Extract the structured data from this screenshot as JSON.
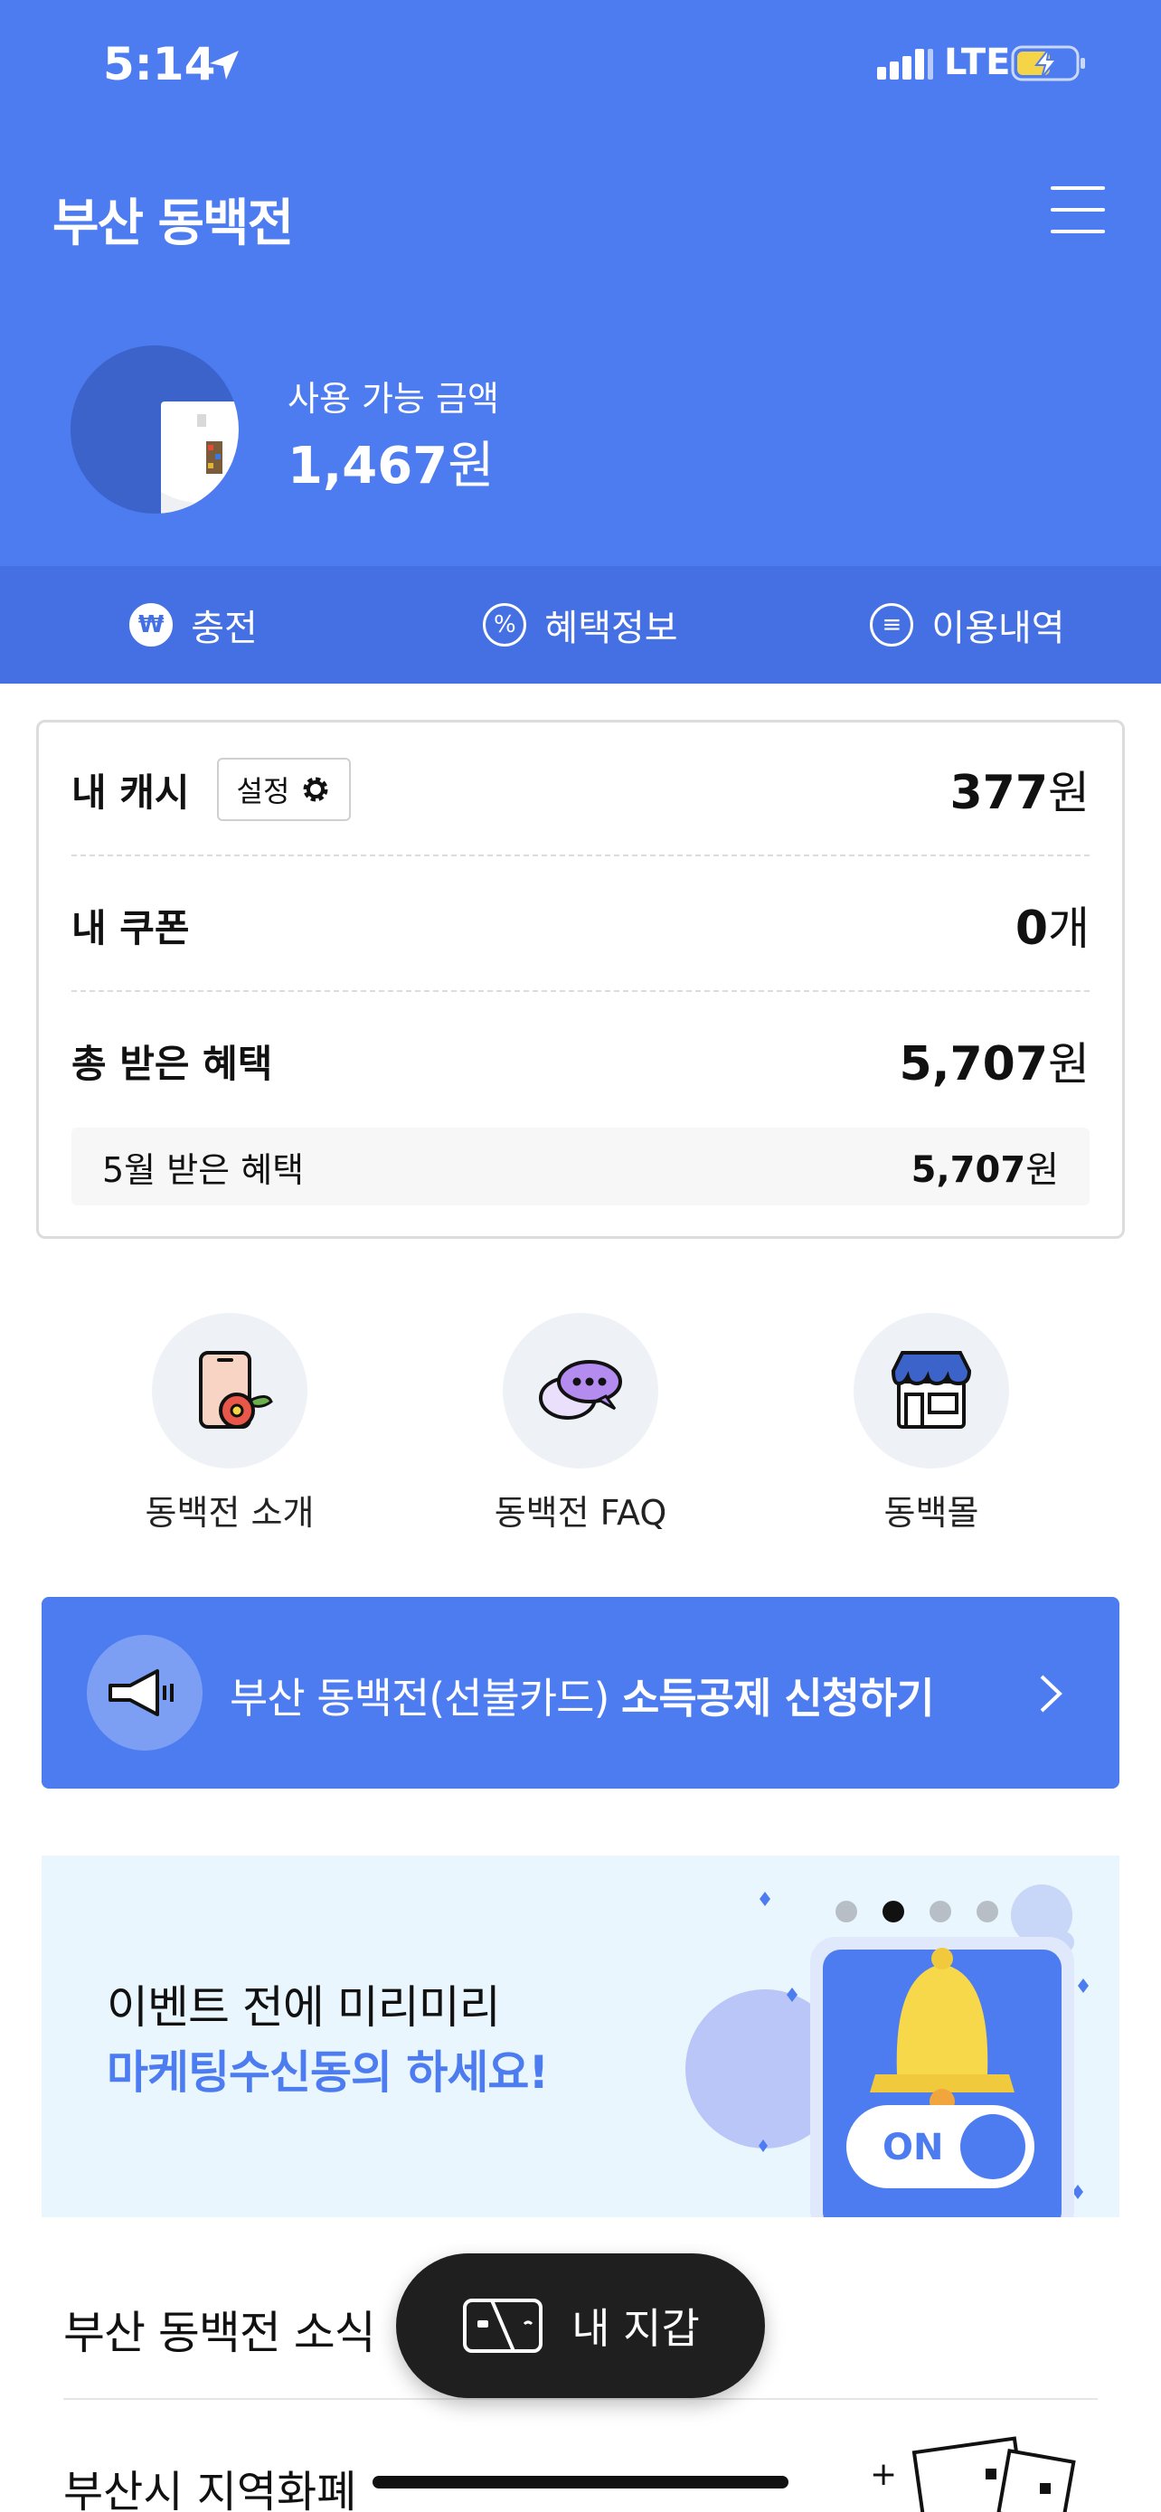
{
  "status_bar": {
    "time": "5:14",
    "network": "LTE"
  },
  "header": {
    "title": "부산 동백전"
  },
  "balance": {
    "label": "사용 가능 금액",
    "amount": "1,467",
    "unit": "원"
  },
  "actions": [
    {
      "label": "충전",
      "icon": "won-icon"
    },
    {
      "label": "혜택정보",
      "icon": "percent-icon"
    },
    {
      "label": "이용내역",
      "icon": "receipt-icon"
    }
  ],
  "summary": {
    "cash_label": "내 캐시",
    "settings_label": "설정",
    "cash_value": "377",
    "cash_unit": "원",
    "coupon_label": "내 쿠폰",
    "coupon_value": "0",
    "coupon_unit": "개",
    "benefit_label": "총 받은 혜택",
    "benefit_value": "5,707",
    "benefit_unit": "원",
    "month_label": "5월 받은 혜택",
    "month_value": "5,707",
    "month_unit": "원"
  },
  "shortcuts": [
    {
      "label": "동백전 소개",
      "icon": "phone-flower-icon"
    },
    {
      "label": "동백전 FAQ",
      "icon": "chat-bubbles-icon"
    },
    {
      "label": "동백몰",
      "icon": "store-icon"
    }
  ],
  "banner": {
    "text_normal": "부산 동백전(선불카드) ",
    "text_bold": "소득공제 신청하기"
  },
  "promo": {
    "line1": "이벤트 전에 미리미리",
    "line2": "마케팅수신동의 하세요!",
    "toggle_text": "ON",
    "slide_active": 2,
    "slide_count": 4
  },
  "news": {
    "title": "부산 동백전 소식",
    "item": "부산시 지역화폐"
  },
  "wallet_button": {
    "label": "내 지갑"
  },
  "colors": {
    "primary": "#4d7cf0",
    "secondary": "#4470e3",
    "dark": "#1f1f1f"
  }
}
